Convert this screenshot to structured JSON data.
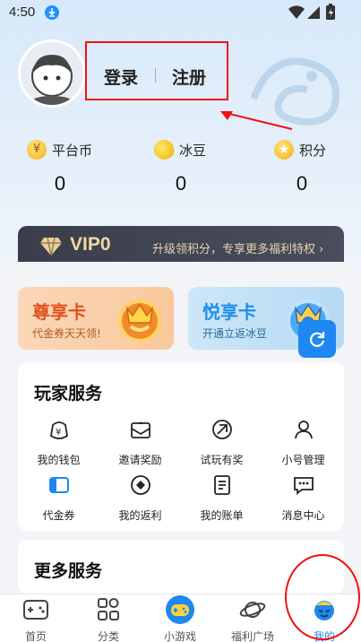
{
  "status": {
    "time": "4:50"
  },
  "auth": {
    "login": "登录",
    "register": "注册"
  },
  "currencies": [
    {
      "label": "平台币",
      "value": "0",
      "icon": "yen-coin-icon",
      "color": "#f2b21c"
    },
    {
      "label": "冰豆",
      "value": "0",
      "icon": "bean-icon",
      "color": "#f4c21c"
    },
    {
      "label": "积分",
      "value": "0",
      "icon": "star-coin-icon",
      "color": "#f2b21c"
    }
  ],
  "vip": {
    "level": "VIP0",
    "desc": "升级领积分，专享更多福利特权 ›"
  },
  "cards": [
    {
      "title": "尊享卡",
      "subtitle": "代金券天天领!"
    },
    {
      "title": "悦享卡",
      "subtitle": "开通立返冰豆"
    }
  ],
  "services": {
    "title": "玩家服务",
    "items": [
      {
        "label": "我的钱包",
        "icon": "wallet-icon"
      },
      {
        "label": "邀请奖励",
        "icon": "invite-icon"
      },
      {
        "label": "试玩有奖",
        "icon": "trial-icon"
      },
      {
        "label": "小号管理",
        "icon": "account-icon"
      },
      {
        "label": "代金券",
        "icon": "voucher-icon"
      },
      {
        "label": "我的返利",
        "icon": "rebate-icon"
      },
      {
        "label": "我的账单",
        "icon": "bill-icon"
      },
      {
        "label": "消息中心",
        "icon": "message-icon"
      }
    ]
  },
  "more": {
    "title": "更多服务"
  },
  "tabs": [
    {
      "label": "首页",
      "icon": "gamepad-icon"
    },
    {
      "label": "分类",
      "icon": "category-icon"
    },
    {
      "label": "小游戏",
      "icon": "mini-game-icon"
    },
    {
      "label": "福利广场",
      "icon": "planet-icon"
    },
    {
      "label": "我的",
      "icon": "profile-icon",
      "active": true
    }
  ],
  "colors": {
    "accent": "#1e88f0",
    "highlight": "#e11111"
  }
}
